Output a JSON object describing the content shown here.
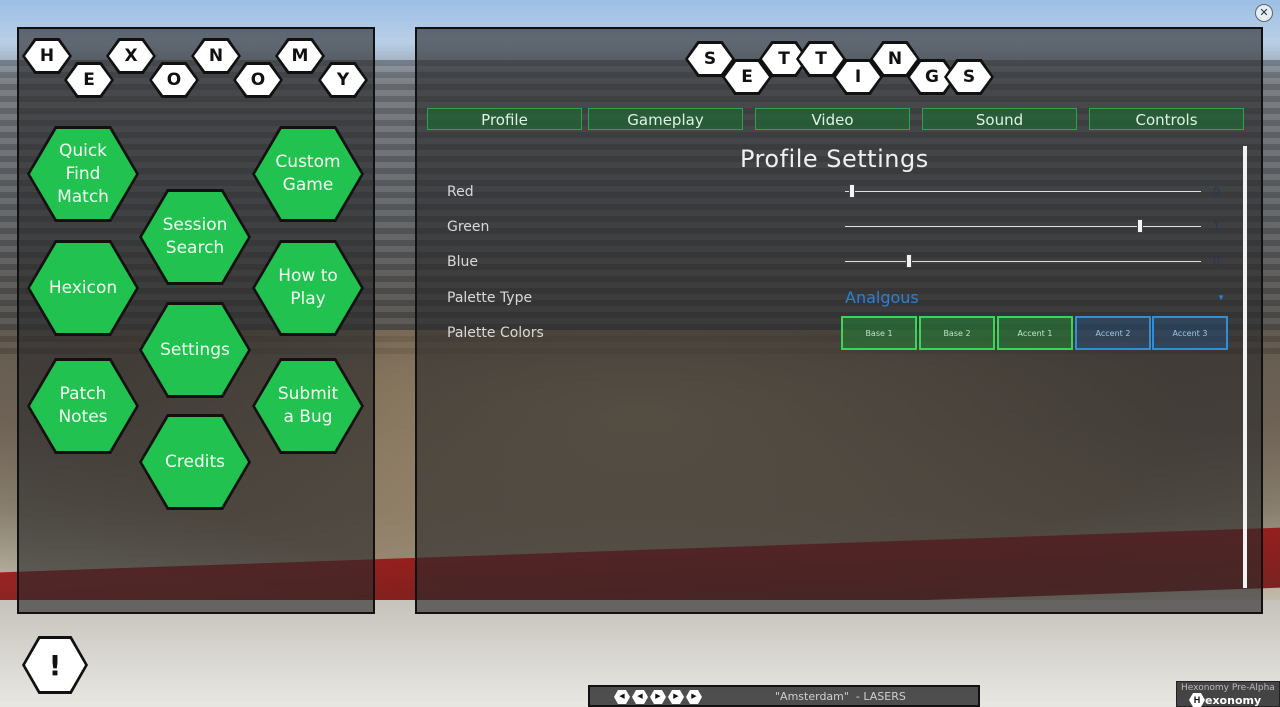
{
  "logo_letters": [
    "H",
    "E",
    "X",
    "O",
    "N",
    "O",
    "M",
    "Y"
  ],
  "menu": {
    "quick_find_match": "Quick\nFind\nMatch",
    "custom_game": "Custom\nGame",
    "session_search": "Session\nSearch",
    "hexicon": "Hexicon",
    "how_to_play": "How to\nPlay",
    "settings": "Settings",
    "patch_notes": "Patch\nNotes",
    "submit_bug": "Submit\na Bug",
    "credits": "Credits"
  },
  "settings_title_letters": [
    "S",
    "E",
    "T",
    "T",
    "I",
    "N",
    "G",
    "S"
  ],
  "tabs": [
    "Profile",
    "Gameplay",
    "Video",
    "Sound",
    "Controls"
  ],
  "profile": {
    "title": "Profile Settings",
    "red_label": "Red",
    "red_value": "0",
    "red_level": 0.02,
    "green_label": "Green",
    "green_value": "1",
    "green_level": 0.83,
    "blue_label": "Blue",
    "blue_value": "0",
    "blue_level": 0.18,
    "palette_type_label": "Palette Type",
    "palette_type_value": "Analgous",
    "palette_colors_label": "Palette Colors",
    "palette_buttons": [
      "Base 1",
      "Base 2",
      "Accent 1",
      "Accent 2",
      "Accent 3"
    ]
  },
  "music": {
    "track": "\"Amsterdam\"  - LASERS",
    "controls": [
      "prev-icon",
      "rewind-icon",
      "play-icon",
      "forward-icon",
      "next-icon"
    ]
  },
  "watermark": {
    "line1": "Hexonomy Pre-Alpha",
    "line2": "Pre-",
    "brand": "exonomy",
    "brand_letter": "H"
  },
  "warning_symbol": "!",
  "close_symbol": "✕",
  "colors": {
    "menu_green": "#21c24f",
    "tab_green": "#2fa24f",
    "accent_blue": "#2b7fd8"
  }
}
